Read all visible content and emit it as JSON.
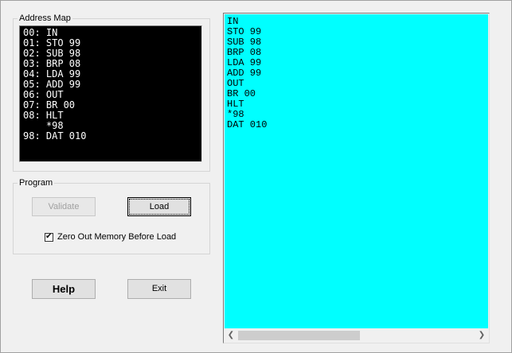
{
  "address_map": {
    "legend": "Address Map",
    "lines": [
      "00: IN",
      "01: STO 99",
      "02: SUB 98",
      "03: BRP 08",
      "04: LDA 99",
      "05: ADD 99",
      "06: OUT",
      "07: BR 00",
      "08: HLT",
      "    *98",
      "98: DAT 010"
    ]
  },
  "program": {
    "legend": "Program",
    "validate_label": "Validate",
    "load_label": "Load",
    "checkbox_label": "Zero Out Memory Before Load",
    "checkbox_checked": true
  },
  "footer": {
    "help_label": "Help",
    "exit_label": "Exit"
  },
  "source": {
    "background": "#00ffff",
    "lines": [
      "IN",
      "STO 99",
      "SUB 98",
      "BRP 08",
      "LDA 99",
      "ADD 99",
      "OUT",
      "BR 00",
      "HLT",
      "*98",
      "DAT 010"
    ]
  },
  "scrollbar": {
    "left_arrow_icon": "chevron-left-icon",
    "right_arrow_icon": "chevron-right-icon"
  }
}
